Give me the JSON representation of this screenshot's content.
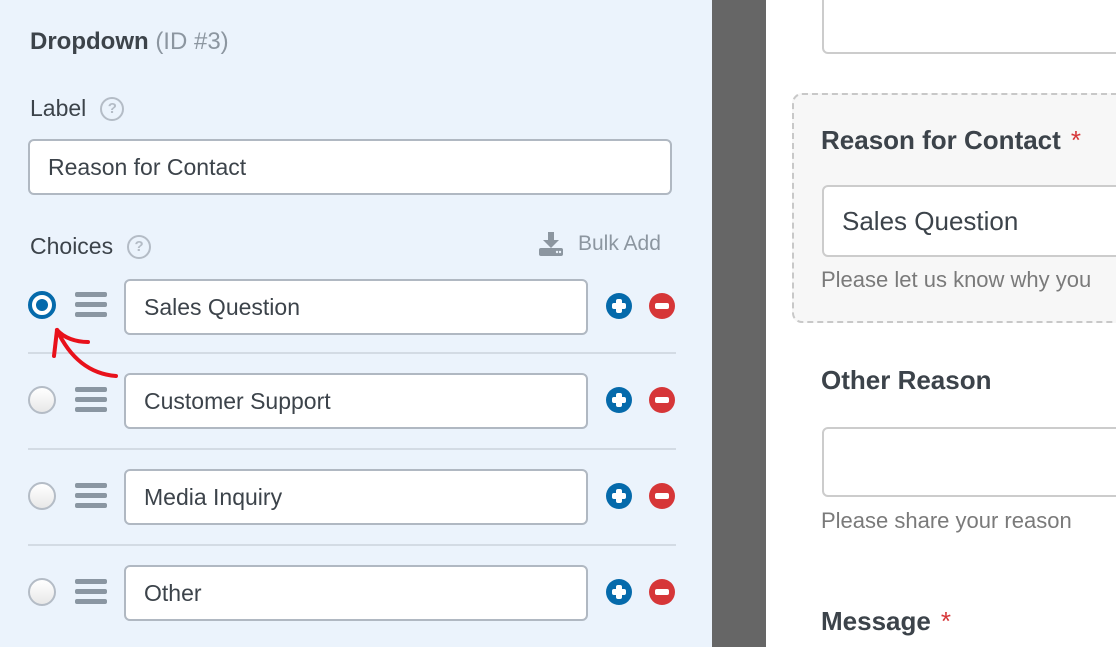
{
  "panel": {
    "title": "Dropdown",
    "id_label": "(ID #3)",
    "label_heading": "Label",
    "label_value": "Reason for Contact",
    "choices_heading": "Choices",
    "bulk_add": "Bulk Add",
    "help_glyph": "?",
    "choices": [
      {
        "value": "Sales Question",
        "selected": true
      },
      {
        "value": "Customer Support",
        "selected": false
      },
      {
        "value": "Media Inquiry",
        "selected": false
      },
      {
        "value": "Other",
        "selected": false
      }
    ]
  },
  "preview": {
    "reason_label": "Reason for Contact",
    "required_mark": "*",
    "reason_value": "Sales Question",
    "reason_description": "Please let us know why you",
    "other_label": "Other Reason",
    "other_value": "",
    "other_description": "Please share your reason",
    "message_label": "Message"
  },
  "colors": {
    "accent": "#056aab",
    "remove": "#d63638",
    "panel_bg": "#ebf3fc",
    "divider": "#666666",
    "annotation_arrow": "#e8111b"
  }
}
